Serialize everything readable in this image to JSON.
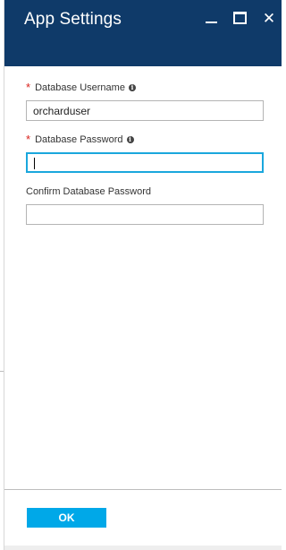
{
  "window": {
    "title": "App Settings",
    "controls": {
      "minimize_icon": "minimize-icon",
      "maximize_icon": "maximize-icon",
      "close_icon": "close-icon",
      "close_glyph": "✕"
    }
  },
  "form": {
    "required_marker": "*",
    "info_glyph": "i",
    "fields": [
      {
        "label": "Database Username",
        "required": true,
        "has_info": true,
        "value": "orcharduser",
        "focused": false
      },
      {
        "label": "Database Password",
        "required": true,
        "has_info": true,
        "value": "",
        "focused": true
      },
      {
        "label": "Confirm Database Password",
        "required": false,
        "has_info": false,
        "value": "",
        "focused": false
      }
    ]
  },
  "footer": {
    "ok_label": "OK"
  },
  "colors": {
    "header_bg": "#0f3a69",
    "accent": "#00a8e8",
    "focus_border": "#1aa7dd",
    "required_marker": "#d9221c"
  }
}
